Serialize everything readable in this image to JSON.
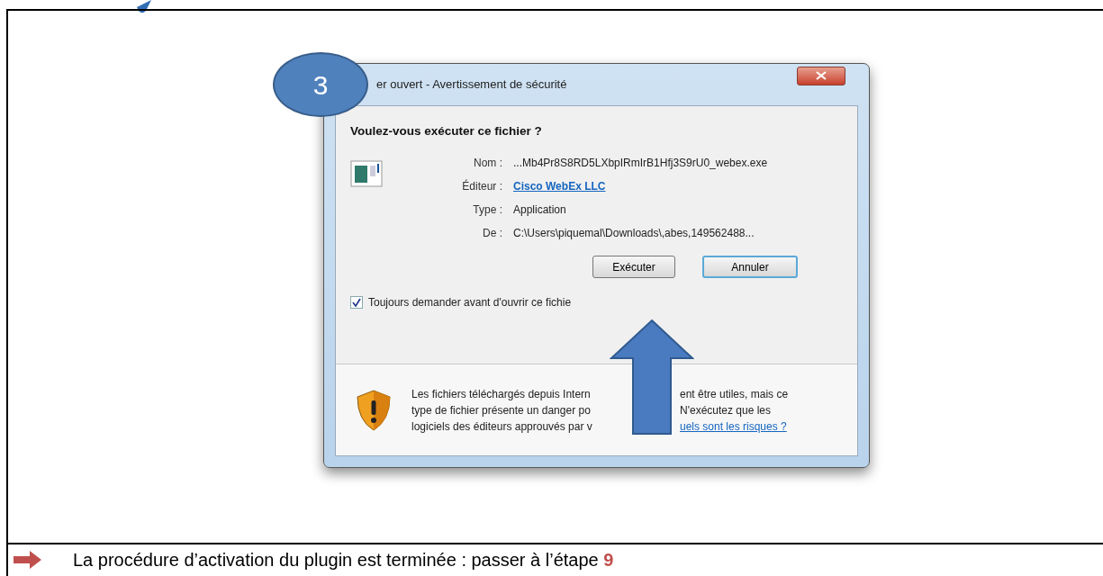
{
  "badge": "3",
  "dialog": {
    "title": "er ouvert - Avertissement de sécurité",
    "heading": "Voulez-vous exécuter ce fichier ?",
    "fields": [
      {
        "label": "Nom :",
        "value": "...Mb4Pr8S8RD5LXbpIRmIrB1Hfj3S9rU0_webex.exe",
        "kind": "text"
      },
      {
        "label": "Éditeur :",
        "value": "Cisco WebEx LLC",
        "kind": "link"
      },
      {
        "label": "Type :",
        "value": "Application",
        "kind": "text"
      },
      {
        "label": "De :",
        "value": "C:\\Users\\piquemal\\Downloads\\,abes,149562488...",
        "kind": "text"
      }
    ],
    "buttons": [
      {
        "label": "Exécuter",
        "default": false
      },
      {
        "label": "Annuler",
        "default": true
      }
    ],
    "checkbox": {
      "label": "Toujours demander avant d'ouvrir ce fichie",
      "checked": true
    },
    "warning": [
      [
        {
          "text": "Les fichiers téléchargés depuis Intern",
          "kind": "text"
        },
        {
          "text": "ent être utiles, mais ce",
          "kind": "text"
        }
      ],
      [
        {
          "text": "type de fichier présente un danger po",
          "kind": "text"
        },
        {
          "text": "N'exécutez que les",
          "kind": "text"
        }
      ],
      [
        {
          "text": "logiciels des éditeurs approuvés par v",
          "kind": "text"
        },
        {
          "text": "uels sont les risques ?",
          "kind": "link"
        }
      ]
    ]
  },
  "footer": "La procédure d’activation du plugin est terminée : passer à l’étape **9**"
}
